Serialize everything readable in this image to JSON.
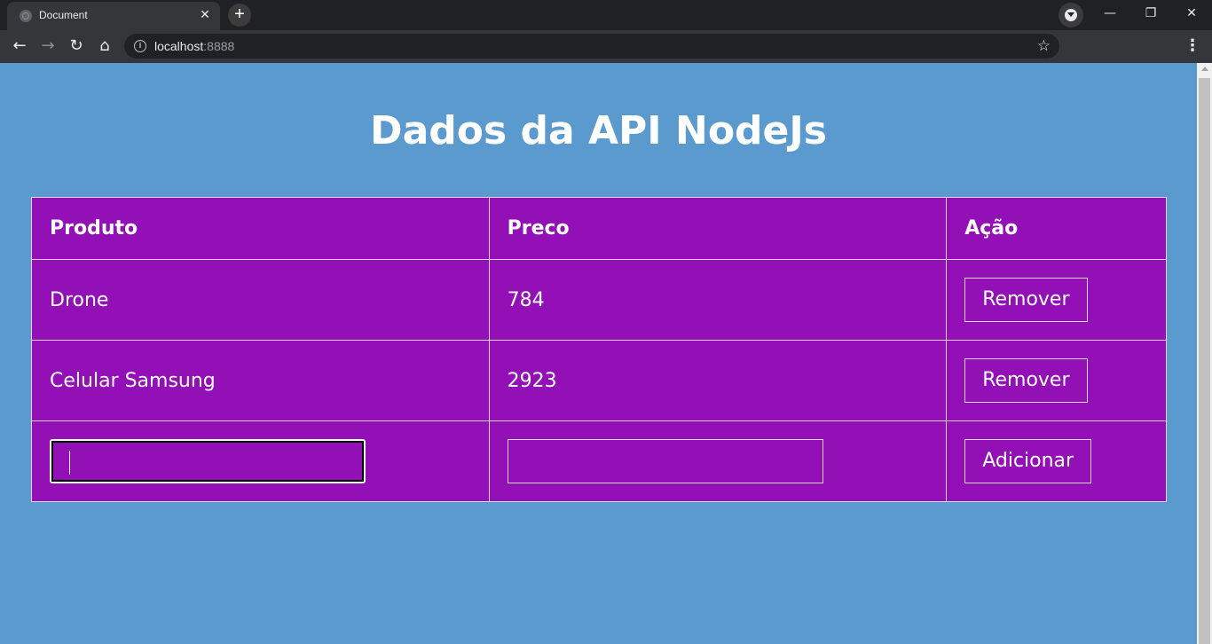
{
  "browser": {
    "tab_title": "Document",
    "tab_close": "✕",
    "new_tab": "+",
    "url_host": "localhost",
    "url_port": ":8888",
    "window_controls": {
      "minimize": "—",
      "restore": "❐",
      "close": "✕"
    },
    "nav": {
      "back": "←",
      "forward": "→",
      "reload": "↻",
      "home": "⌂"
    },
    "info": "i",
    "star": "☆",
    "menu": "⋮"
  },
  "page": {
    "title": "Dados da API NodeJs"
  },
  "table": {
    "headers": [
      "Produto",
      "Preco",
      "Ação"
    ],
    "rows": [
      {
        "produto": "Drone",
        "preco": "784",
        "action": "Remover"
      },
      {
        "produto": "Celular Samsung",
        "preco": "2923",
        "action": "Remover"
      }
    ],
    "form": {
      "produto_value": "",
      "preco_value": "",
      "add_label": "Adicionar"
    }
  },
  "colors": {
    "page_background": "#5a9acf",
    "table_background": "#9210b6",
    "text": "#ffffff"
  }
}
